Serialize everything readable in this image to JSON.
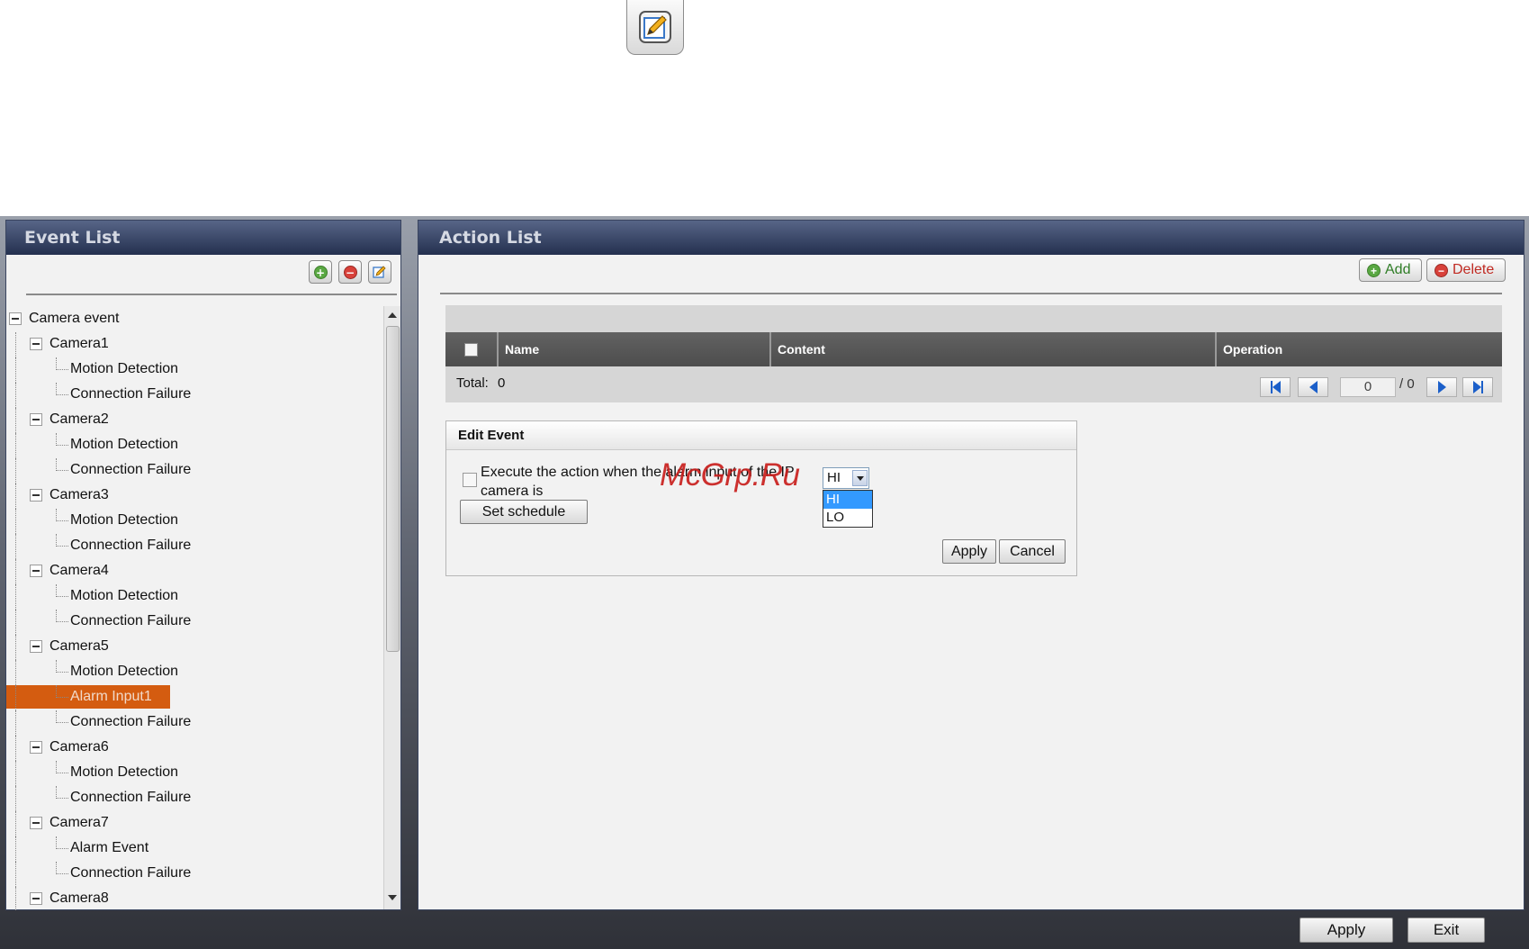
{
  "top_icon": "edit-note-icon",
  "event_panel": {
    "title": "Event List",
    "toolbar_icons": [
      "add-icon",
      "remove-icon",
      "edit-icon"
    ],
    "tree": [
      {
        "label": "Camera event",
        "level": 0
      },
      {
        "label": "Camera1",
        "level": 1
      },
      {
        "label": "Motion Detection",
        "level": 2
      },
      {
        "label": "Connection Failure",
        "level": 2
      },
      {
        "label": "Camera2",
        "level": 1
      },
      {
        "label": "Motion Detection",
        "level": 2
      },
      {
        "label": "Connection Failure",
        "level": 2
      },
      {
        "label": "Camera3",
        "level": 1
      },
      {
        "label": "Motion Detection",
        "level": 2
      },
      {
        "label": "Connection Failure",
        "level": 2
      },
      {
        "label": "Camera4",
        "level": 1
      },
      {
        "label": "Motion Detection",
        "level": 2
      },
      {
        "label": "Connection Failure",
        "level": 2
      },
      {
        "label": "Camera5",
        "level": 1
      },
      {
        "label": "Motion Detection",
        "level": 2
      },
      {
        "label": "Alarm Input1",
        "level": 2,
        "selected": true
      },
      {
        "label": "Connection Failure",
        "level": 2
      },
      {
        "label": "Camera6",
        "level": 1
      },
      {
        "label": "Motion Detection",
        "level": 2
      },
      {
        "label": "Connection Failure",
        "level": 2
      },
      {
        "label": "Camera7",
        "level": 1
      },
      {
        "label": "Alarm Event",
        "level": 2
      },
      {
        "label": "Connection Failure",
        "level": 2
      },
      {
        "label": "Camera8",
        "level": 1
      }
    ]
  },
  "action_panel": {
    "title": "Action List",
    "add_label": "Add",
    "delete_label": "Delete",
    "columns": [
      "Name",
      "Content",
      "Operation"
    ],
    "total_label": "Total:",
    "total_value": "0",
    "page_current": "0",
    "page_total": "/ 0"
  },
  "edit_event": {
    "title": "Edit Event",
    "checkbox_text": "Execute the action when the alarm input of the IP camera is",
    "select_value": "HI",
    "options": [
      "HI",
      "LO"
    ],
    "highlighted_option": "HI",
    "schedule_label": "Set schedule",
    "apply_label": "Apply",
    "cancel_label": "Cancel"
  },
  "watermark": "McGrp.Ru",
  "footer": {
    "apply_label": "Apply",
    "exit_label": "Exit"
  },
  "colors": {
    "header_gradient_top": "#576587",
    "header_gradient_bottom": "#24304f",
    "selection": "#d45c10",
    "dropdown_highlight": "#3399ff",
    "watermark": "#c9201e"
  }
}
